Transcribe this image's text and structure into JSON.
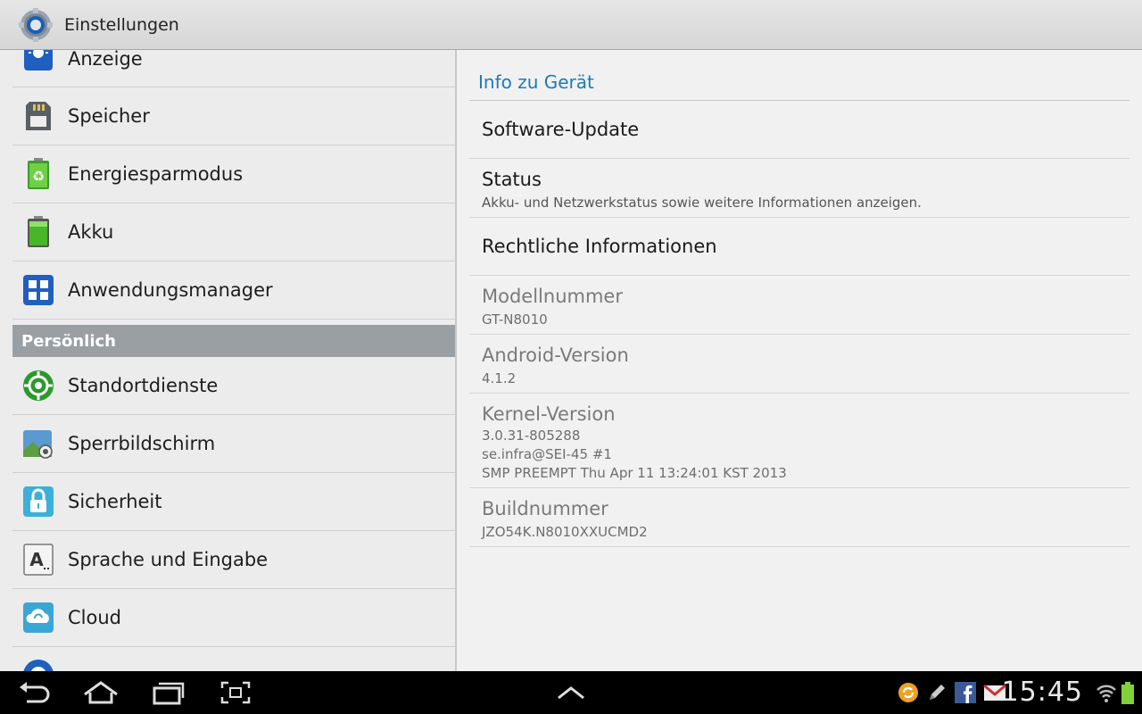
{
  "actionbar": {
    "title": "Einstellungen",
    "icon": "settings-gear-icon"
  },
  "left_list": {
    "items_top": [
      {
        "label": "Anzeige",
        "icon": "display-icon"
      },
      {
        "label": "Speicher",
        "icon": "sd-card-icon"
      },
      {
        "label": "Energiesparmodus",
        "icon": "power-saving-icon"
      },
      {
        "label": "Akku",
        "icon": "battery-icon"
      },
      {
        "label": "Anwendungsmanager",
        "icon": "app-manager-icon"
      }
    ],
    "section_header": "Persönlich",
    "items_personal": [
      {
        "label": "Standortdienste",
        "icon": "location-icon"
      },
      {
        "label": "Sperrbildschirm",
        "icon": "lock-screen-icon"
      },
      {
        "label": "Sicherheit",
        "icon": "padlock-icon"
      },
      {
        "label": "Sprache und Eingabe",
        "icon": "keyboard-letter-icon"
      },
      {
        "label": "Cloud",
        "icon": "cloud-icon"
      }
    ]
  },
  "right_pane": {
    "title": "Info zu Gerät",
    "rows": [
      {
        "title": "Software-Update"
      },
      {
        "title": "Status",
        "summary": "Akku- und Netzwerkstatus sowie weitere Informationen anzeigen."
      },
      {
        "title": "Rechtliche Informationen"
      },
      {
        "title": "Modellnummer",
        "summary": "GT-N8010"
      },
      {
        "title": "Android-Version",
        "summary": "4.1.2"
      },
      {
        "title": "Kernel-Version",
        "summary_lines": [
          "3.0.31-805288",
          "se.infra@SEI-45 #1",
          "SMP PREEMPT Thu Apr 11 13:24:01 KST 2013"
        ]
      },
      {
        "title": "Buildnummer",
        "summary": "JZO54K.N8010XXUCMD2"
      }
    ]
  },
  "navbar": {
    "clock": "15:45",
    "buttons": [
      "back-icon",
      "home-icon",
      "recent-apps-icon",
      "screenshot-icon",
      "menu-up-icon"
    ],
    "status_icons": [
      "sync-icon",
      "pen-icon",
      "facebook-icon",
      "gmail-icon",
      "wifi-icon",
      "battery-status-icon"
    ]
  },
  "colors": {
    "accent": "#1e7ab5",
    "section": "#9a9fa3",
    "navbar": "#000000"
  }
}
